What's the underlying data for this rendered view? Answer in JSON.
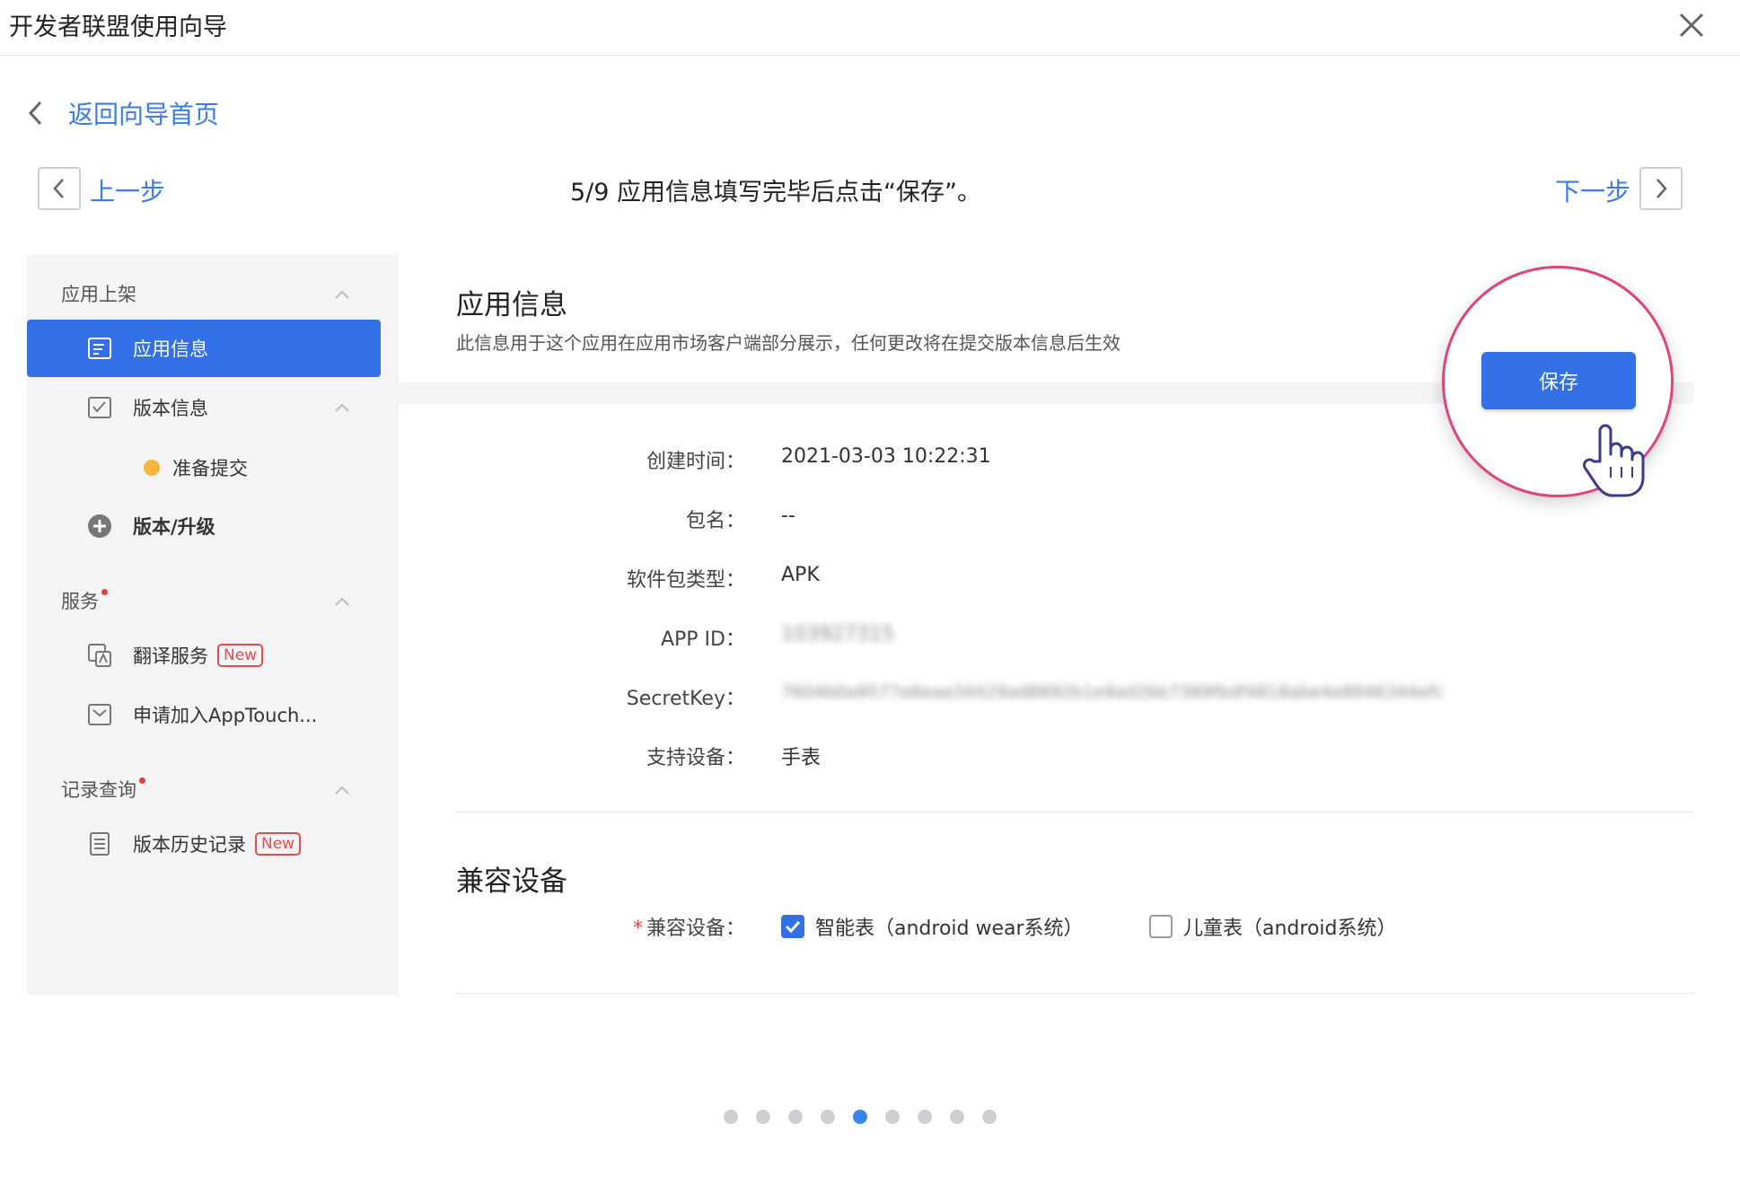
{
  "dialog": {
    "title": "开发者联盟使用向导"
  },
  "back_link": "返回向导首页",
  "steps": {
    "prev_label": "上一步",
    "next_label": "下一步",
    "current_text": "5/9 应用信息填写完毕后点击“保存”。"
  },
  "sidebar": {
    "group_publish": "应用上架",
    "item_app_info": "应用信息",
    "item_version_info": "版本信息",
    "sub_pending": "准备提交",
    "item_upgrade": "版本/升级",
    "group_services": "服务",
    "item_translate": "翻译服务",
    "item_apptouch": "申请加入AppTouch...",
    "group_records": "记录查询",
    "item_history": "版本历史记录",
    "badge_new": "New"
  },
  "app_info": {
    "title": "应用信息",
    "description": "此信息用于这个应用在应用市场客户端部分展示，任何更改将在提交版本信息后生效",
    "save_label": "保存",
    "rows": [
      {
        "label": "创建时间：",
        "value": "2021-03-03 10:22:31"
      },
      {
        "label": "包名：",
        "value": "--"
      },
      {
        "label": "软件包类型：",
        "value": "APK"
      },
      {
        "label": "APP ID：",
        "value": "103927315"
      },
      {
        "label": "SecretKey：",
        "value": "7604b0a9577e6eaa34429ad8892b1e9ad2bb7389fbdf4818abe4e8946344efc"
      },
      {
        "label": "支持设备：",
        "value": "手表"
      }
    ]
  },
  "compat": {
    "title": "兼容设备",
    "label": "兼容设备：",
    "required_mark": "*",
    "option_smartwatch": "智能表（android wear系统）",
    "option_kidswatch": "儿童表（android系统）"
  },
  "pagination": {
    "total": 9,
    "current": 5
  },
  "colors": {
    "accent": "#3370e6",
    "link": "#3a7ce8",
    "highlight_ring": "#e0437e",
    "pending": "#f5b63a"
  }
}
